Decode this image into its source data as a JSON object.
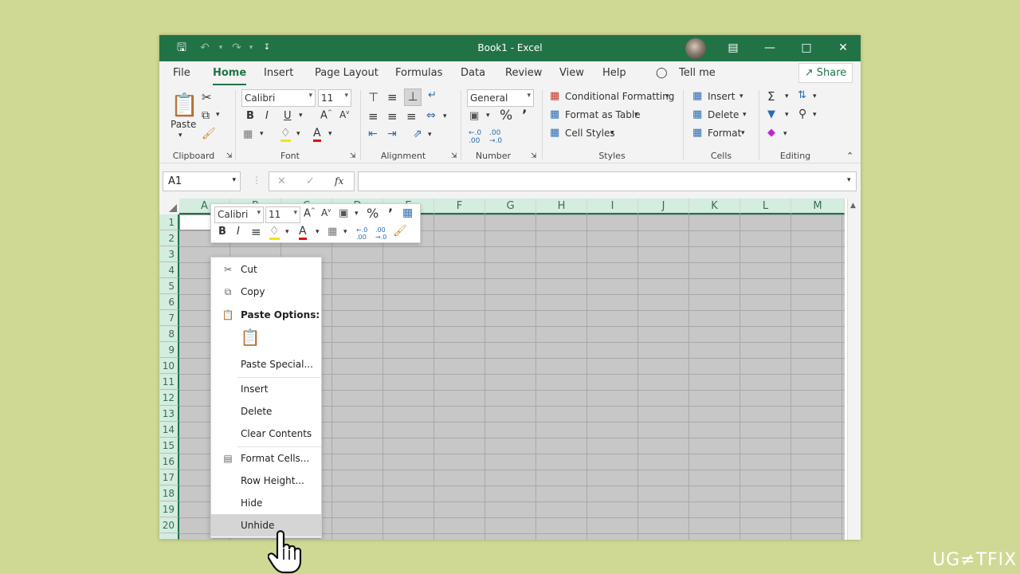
{
  "window": {
    "title": "Book1  -  Excel"
  },
  "menu": [
    "File",
    "Home",
    "Insert",
    "Page Layout",
    "Formulas",
    "Data",
    "Review",
    "View",
    "Help"
  ],
  "tell_me": "Tell me",
  "share": "Share",
  "ribbon": {
    "clipboard": {
      "paste": "Paste",
      "label": "Clipboard"
    },
    "font": {
      "name": "Calibri",
      "size": "11",
      "label": "Font"
    },
    "alignment": {
      "label": "Alignment"
    },
    "number": {
      "format": "General",
      "label": "Number"
    },
    "styles": {
      "conditional": "Conditional Formatting",
      "table": "Format as Table",
      "cell_styles": "Cell Styles",
      "label": "Styles"
    },
    "cells": {
      "insert": "Insert",
      "delete": "Delete",
      "format": "Format",
      "label": "Cells"
    },
    "editing": {
      "label": "Editing"
    }
  },
  "formula_bar": {
    "name_box": "A1",
    "fx": "fx",
    "formula": ""
  },
  "columns": [
    "A",
    "B",
    "C",
    "D",
    "E",
    "F",
    "G",
    "H",
    "I",
    "J",
    "K",
    "L",
    "M"
  ],
  "rows": [
    "1",
    "2",
    "3",
    "4",
    "5",
    "6",
    "7",
    "8",
    "9",
    "10",
    "11",
    "12",
    "13",
    "14",
    "15",
    "16",
    "17",
    "18",
    "19",
    "20"
  ],
  "mini_toolbar": {
    "font": "Calibri",
    "size": "11"
  },
  "context_menu": {
    "cut": "Cut",
    "copy": "Copy",
    "paste_options": "Paste Options:",
    "paste_special": "Paste Special...",
    "insert": "Insert",
    "delete": "Delete",
    "clear_contents": "Clear Contents",
    "format_cells": "Format Cells...",
    "row_height": "Row Height...",
    "hide": "Hide",
    "unhide": "Unhide"
  },
  "watermark": "UG≠TFIX",
  "colors": {
    "excel_green": "#217346",
    "header_bg": "#d3ede0",
    "background": "#cfd994"
  }
}
